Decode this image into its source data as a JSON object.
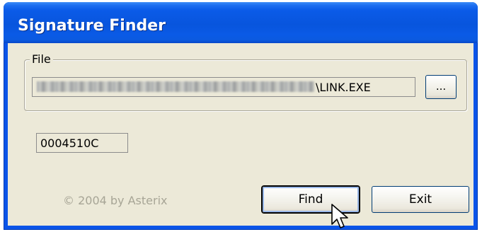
{
  "window": {
    "title": "Signature Finder"
  },
  "file_group": {
    "label": "File",
    "path_visible_suffix": "\\LINK.EXE",
    "browse_label": "..."
  },
  "result": {
    "value": "0004510C"
  },
  "footer": {
    "copyright": "© 2004 by Asterix"
  },
  "buttons": {
    "find_label": "Find",
    "exit_label": "Exit"
  },
  "icons": {
    "cursor": "mouse-pointer-icon"
  },
  "colors": {
    "titlebar": "#0a54e8",
    "dialog_background": "#ece9d8",
    "copyright_text": "#a7a596"
  }
}
